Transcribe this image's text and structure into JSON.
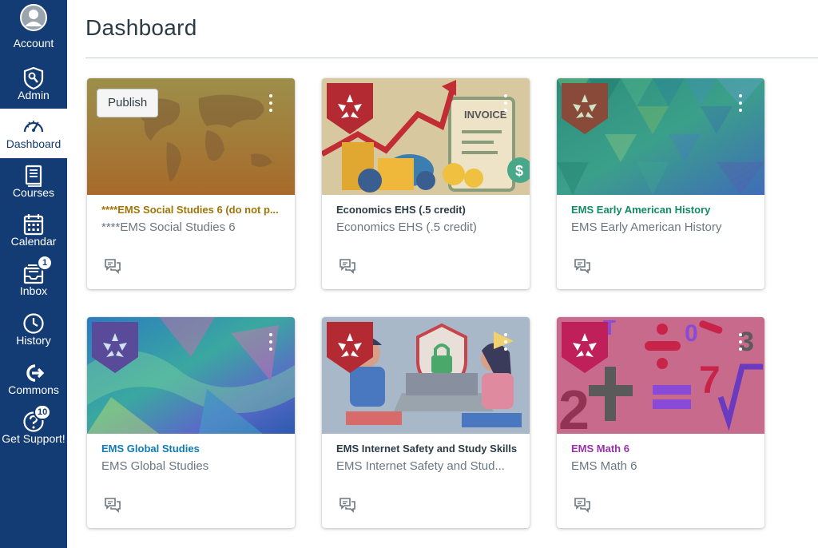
{
  "page": {
    "title": "Dashboard"
  },
  "nav": {
    "items": [
      {
        "id": "account",
        "label": "Account",
        "icon": "account-avatar-icon"
      },
      {
        "id": "admin",
        "label": "Admin",
        "icon": "admin-shield-icon"
      },
      {
        "id": "dashboard",
        "label": "Dashboard",
        "icon": "dashboard-gauge-icon",
        "active": true
      },
      {
        "id": "courses",
        "label": "Courses",
        "icon": "courses-book-icon"
      },
      {
        "id": "calendar",
        "label": "Calendar",
        "icon": "calendar-icon"
      },
      {
        "id": "inbox",
        "label": "Inbox",
        "icon": "inbox-icon",
        "badge": "1"
      },
      {
        "id": "history",
        "label": "History",
        "icon": "history-clock-icon"
      },
      {
        "id": "commons",
        "label": "Commons",
        "icon": "commons-arrow-icon"
      },
      {
        "id": "support",
        "label": "Get Support!",
        "icon": "help-question-icon",
        "badge": "10"
      }
    ]
  },
  "cards": [
    {
      "title": "****EMS Social Studies 6 (do not p...",
      "subtitle": "****EMS Social Studies 6",
      "title_color": "#a07508",
      "hero_color": "#a86a2a",
      "publish_label": "Publish",
      "image": "world map"
    },
    {
      "title": "Economics EHS (.5 credit)",
      "subtitle": "Economics EHS (.5 credit)",
      "title_color": "#2d3b45",
      "hero_color": "#c9b07a",
      "image": "invoice and coins"
    },
    {
      "title": "EMS Early American History",
      "subtitle": "EMS Early American History",
      "title_color": "#138a63",
      "hero_color": "#2f9a8a",
      "image": "triangle mosaic"
    },
    {
      "title": "EMS Global Studies",
      "subtitle": "EMS Global Studies",
      "title_color": "#0e7bb5",
      "hero_color": "#3a8ab8",
      "image": "abstract gradient"
    },
    {
      "title": "EMS Internet Safety and Study Skills",
      "subtitle": "EMS Internet Safety and Stud...",
      "title_color": "#2d3b45",
      "hero_color": "#8aa0b5",
      "image": "kids with laptop"
    },
    {
      "title": "EMS Math 6",
      "subtitle": "EMS Math 6",
      "title_color": "#9b2fae",
      "hero_color": "#c76a8a",
      "image": "math symbols"
    }
  ]
}
